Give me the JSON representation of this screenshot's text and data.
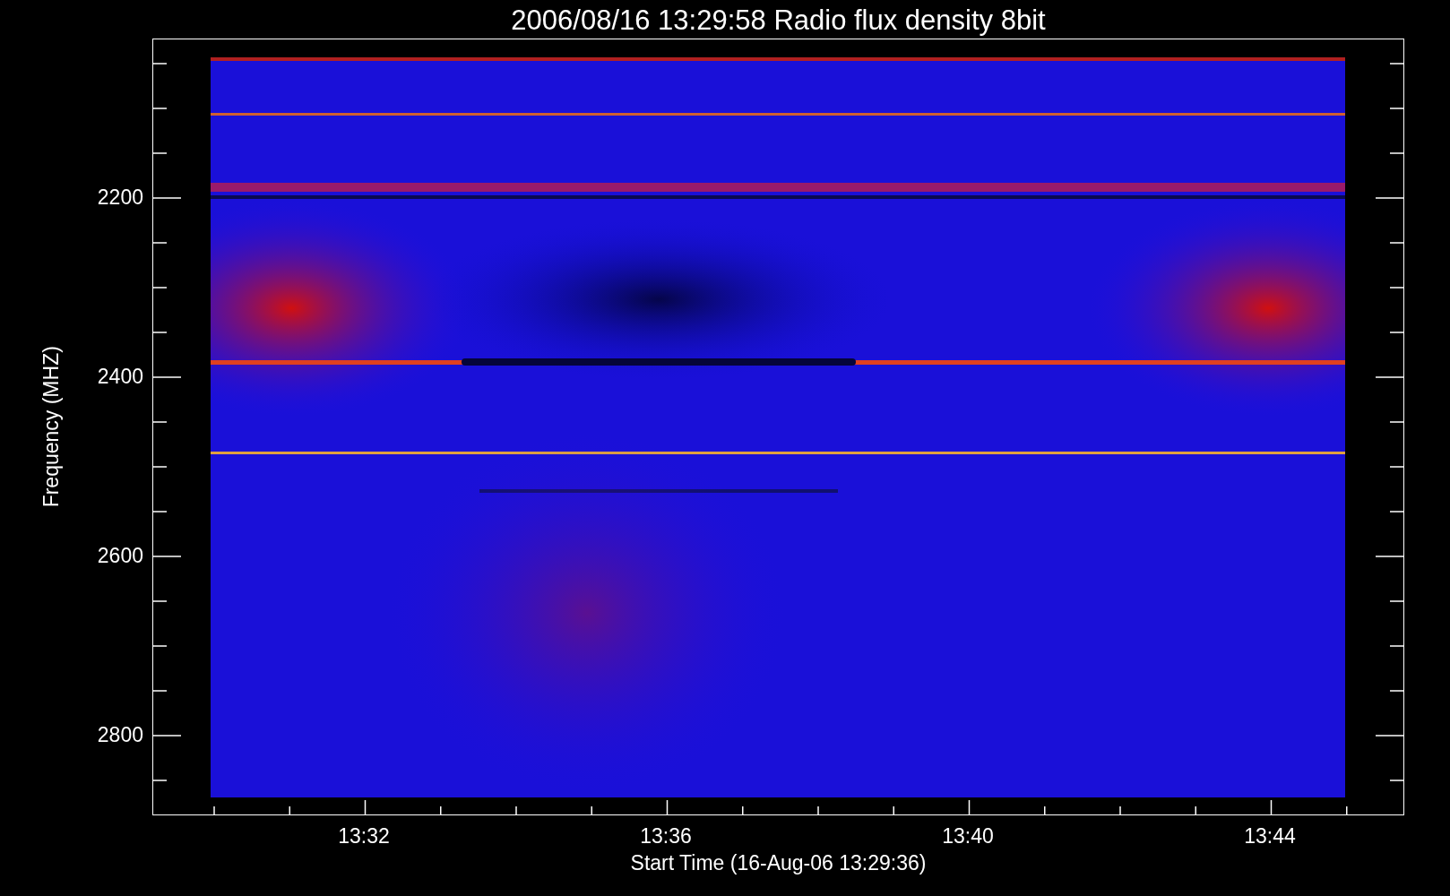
{
  "title": "2006/08/16 13:29:58 Radio flux density 8bit",
  "y_axis": {
    "label": "Frequency (MHZ)",
    "ticks": [
      "2200",
      "2400",
      "2600",
      "2800"
    ]
  },
  "x_axis": {
    "label": "Start Time (16-Aug-06 13:29:36)",
    "ticks": [
      "13:32",
      "13:36",
      "13:40",
      "13:44"
    ]
  }
}
